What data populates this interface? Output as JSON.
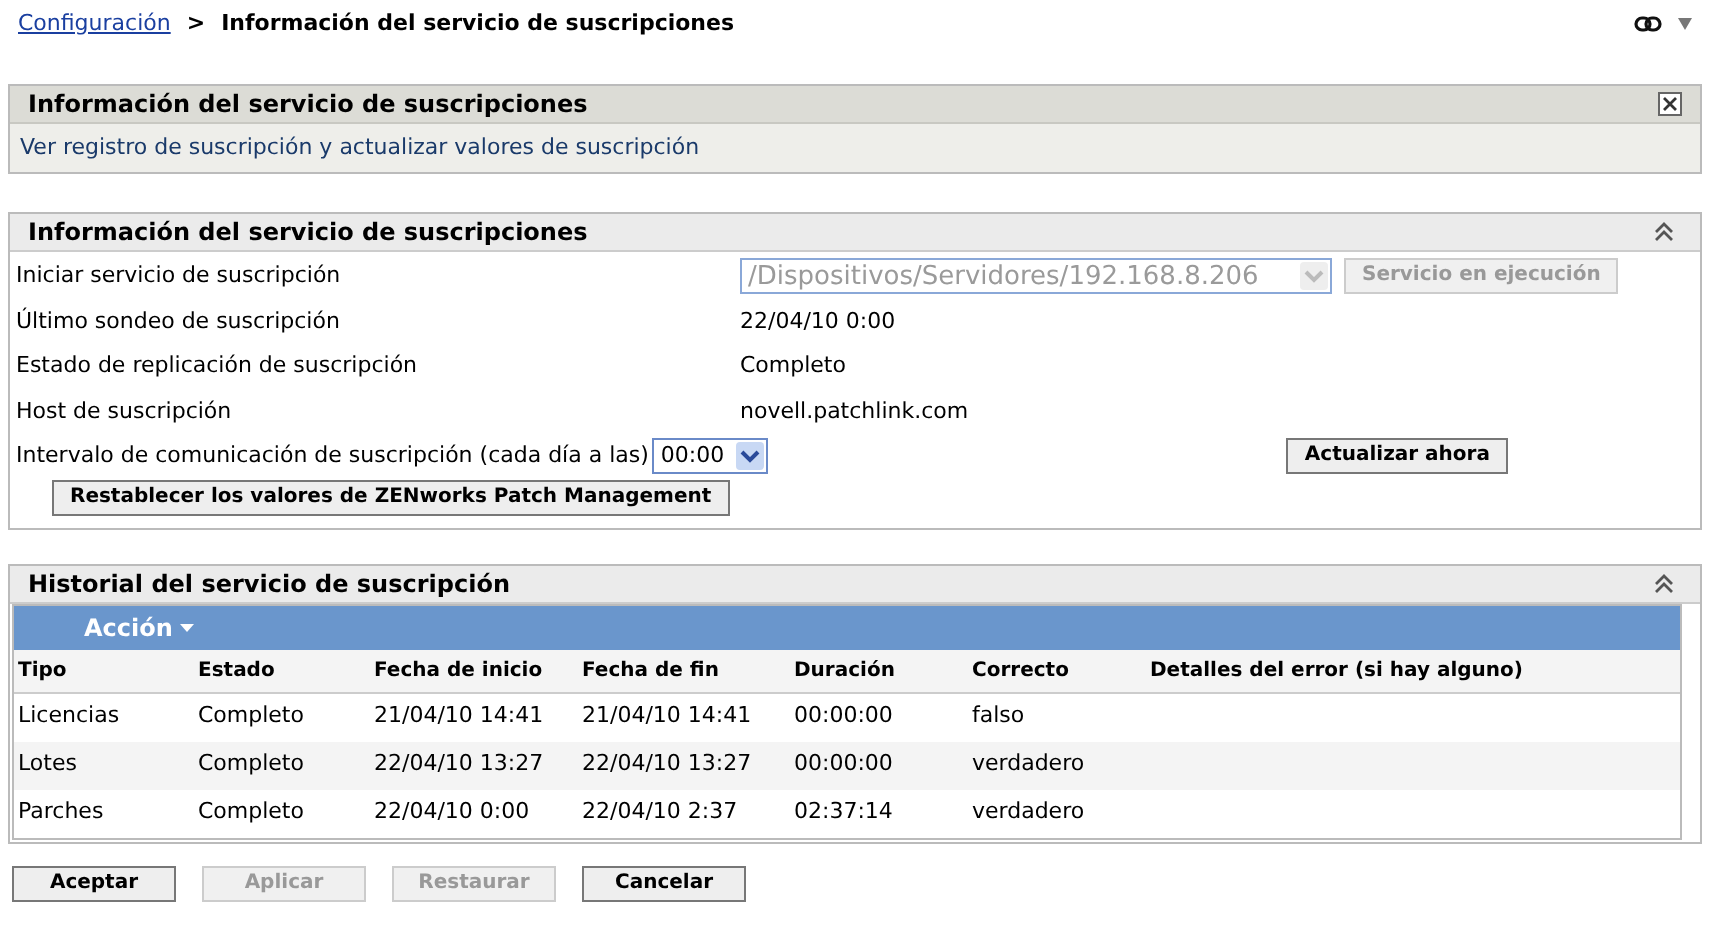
{
  "breadcrumb": {
    "link": "Configuración",
    "separator": ">",
    "current": "Información del servicio de suscripciones"
  },
  "info_panel": {
    "title": "Información del servicio de suscripciones",
    "description": "Ver registro de suscripción y actualizar valores de suscripción"
  },
  "settings_panel": {
    "title": "Información del servicio de suscripciones",
    "rows": [
      {
        "kind": "select",
        "label": "Iniciar servicio de suscripción",
        "value": "/Dispositivos/Servidores/192.168.8.206",
        "disabled": true,
        "button": {
          "label": "Servicio en ejecución",
          "disabled": true
        }
      },
      {
        "kind": "text",
        "label": "Último sondeo de suscripción",
        "value": "22/04/10 0:00"
      },
      {
        "kind": "text",
        "label": "Estado de replicación de suscripción",
        "value": "Completo"
      },
      {
        "kind": "text",
        "label": "Host de suscripción",
        "value": "novell.patchlink.com"
      },
      {
        "kind": "select",
        "label": "Intervalo de comunicación de suscripción (cada día a las)",
        "value": "00:00",
        "disabled": false,
        "button": {
          "label": "Actualizar ahora",
          "disabled": false
        }
      }
    ],
    "reset_button": "Restablecer los valores de ZENworks Patch Management"
  },
  "history_panel": {
    "title": "Historial del servicio de suscripción",
    "action_menu": "Acción",
    "table": {
      "columns": [
        "Tipo",
        "Estado",
        "Fecha de inicio",
        "Fecha de fin",
        "Duración",
        "Correcto",
        "Detalles del error (si hay alguno)"
      ],
      "rows": [
        [
          "Licencias",
          "Completo",
          "21/04/10 14:41",
          "21/04/10 14:41",
          "00:00:00",
          "falso"
        ],
        [
          "Lotes",
          "Completo",
          "22/04/10 13:27",
          "22/04/10 13:27",
          "00:00:00",
          "verdadero"
        ],
        [
          "Parches",
          "Completo",
          "22/04/10 0:00",
          "22/04/10 2:37",
          "02:37:14",
          "verdadero"
        ]
      ]
    }
  },
  "buttons": [
    {
      "label": "Aceptar",
      "disabled": false
    },
    {
      "label": "Aplicar",
      "disabled": true
    },
    {
      "label": "Restaurar",
      "disabled": true
    },
    {
      "label": "Cancelar",
      "disabled": false
    }
  ]
}
